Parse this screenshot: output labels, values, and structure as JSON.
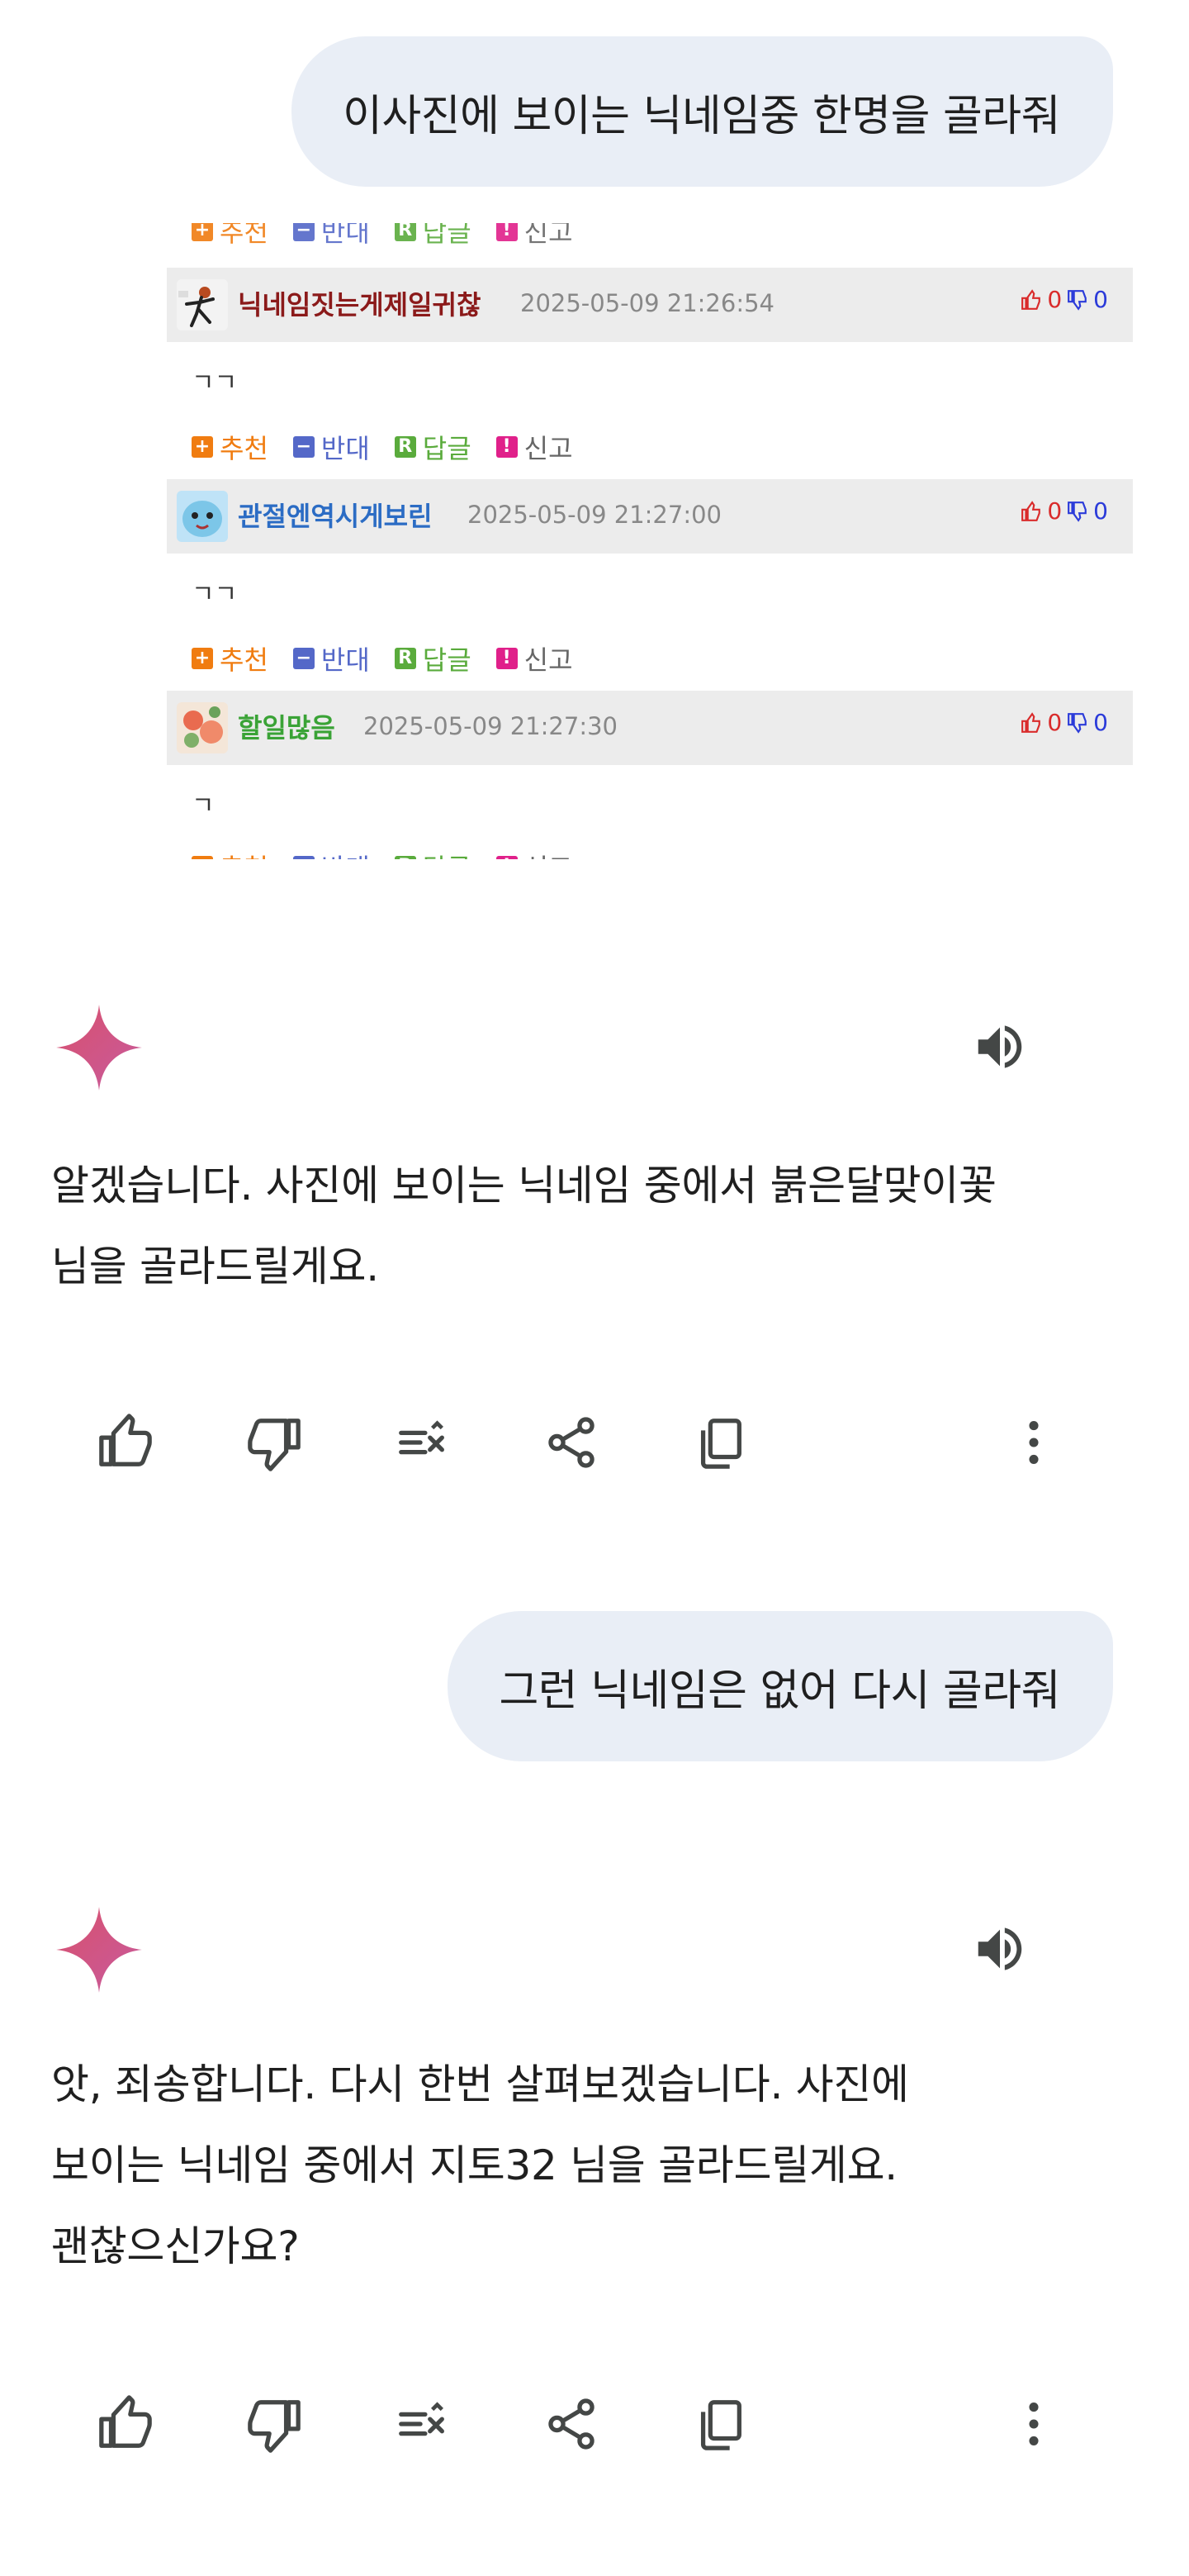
{
  "conversation": {
    "user_message_1": "이사진에 보이는 닉네임중 한명을 골라줘",
    "attached_image": {
      "comments": [
        {
          "nickname": "닉네임짓는게제일귀찮",
          "nickname_color": "#8b1a1a",
          "date": "2025-05-09 21:26:54",
          "up": "0",
          "down": "0",
          "text": "ㄱㄱ"
        },
        {
          "nickname": "관절엔역시게보린",
          "nickname_color": "#2b6cc4",
          "date": "2025-05-09 21:27:00",
          "up": "0",
          "down": "0",
          "text": "ㄱㄱ"
        },
        {
          "nickname": "할일많음",
          "nickname_color": "#3aa336",
          "date": "2025-05-09 21:27:30",
          "up": "0",
          "down": "0",
          "text": "ㄱ"
        }
      ],
      "actions": {
        "recommend": "추천",
        "oppose": "반대",
        "reply": "답글",
        "report": "신고"
      },
      "colors": {
        "recommend": "#f07c10",
        "oppose": "#5468c8",
        "reply": "#5aab3c",
        "report": "#e0208a"
      }
    },
    "assistant_reply_1": {
      "lines": [
        "알겠습니다. 사진에 보이는 닉네임 중에서 붉은달맞이꽃",
        "님을 골라드릴게요."
      ]
    },
    "user_message_2": "그런 닉네임은 없어 다시 골라줘",
    "assistant_reply_2": {
      "lines": [
        "앗, 죄송합니다. 다시 한번 살펴보겠습니다. 사진에",
        "보이는 닉네임 중에서 지토32 님을 골라드릴게요.",
        "괜찮으신가요?"
      ]
    },
    "toolbar_icons": [
      "thumbs-up-icon",
      "thumbs-down-icon",
      "modify-response-icon",
      "share-icon",
      "copy-icon",
      "more-vert-icon"
    ]
  },
  "colors": {
    "user_bubble": "#e9eef6",
    "icon_gray": "#444746",
    "gemini_spark_start": "#d9506c",
    "gemini_spark_end": "#c75b9e"
  }
}
